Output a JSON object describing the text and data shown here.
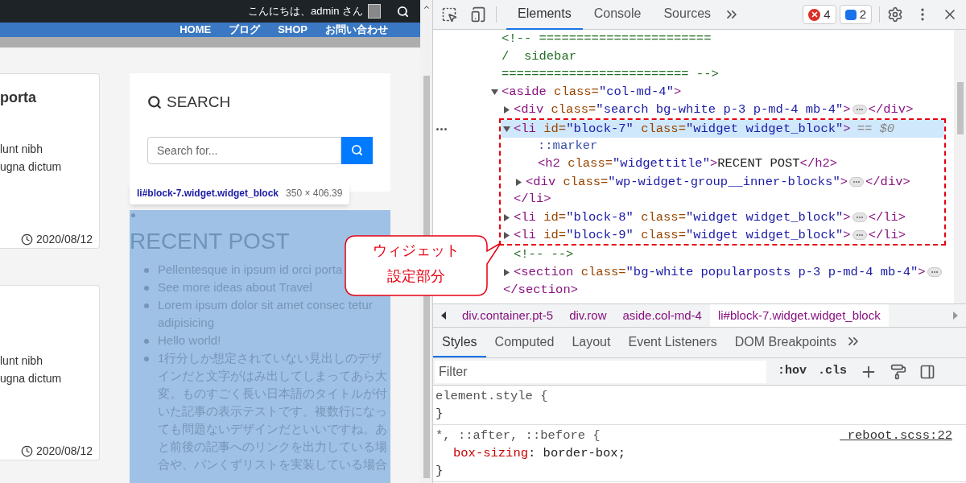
{
  "page": {
    "greeting": "こんにちは、admin さん",
    "nav": [
      "HOME",
      "ブログ",
      "SHOP",
      "お問い合わせ"
    ],
    "posts": [
      {
        "title": "porta",
        "lines": [
          "lunt nibh",
          "ugna dictum"
        ],
        "date": "2020/08/12"
      },
      {
        "lines": [
          "lunt nibh",
          "ugna dictum"
        ],
        "date": "2020/08/12"
      }
    ],
    "search_widget": {
      "title": "SEARCH",
      "placeholder": "Search for..."
    },
    "tooltip": {
      "selector": "li#block-7.widget.widget_block",
      "size": "350 × 406.39"
    },
    "recent": {
      "title": "RECENT POST",
      "items": [
        "Pellentesque in ipsum id orci porta",
        "See more ideas about Travel",
        "Lorem ipsum dolor sit amet consec tetur adipisicing",
        "Hello world!",
        "1行分しか想定されていない見出しのデザインだと文字がはみ出してしまってあら大変。ものすごく長い日本語のタイトルが付いた記事の表示テストです。複数行になっても問題ないデザインだといいですね。あと前後の記事へのリンクを出力している場合や、パンくずリストを実装している場合"
      ]
    }
  },
  "callout": {
    "lines": [
      "ウィジェット",
      "設定部分"
    ]
  },
  "devtools": {
    "tabs": [
      {
        "label": "Elements",
        "selected": true
      },
      {
        "label": "Console",
        "selected": false
      },
      {
        "label": "Sources",
        "selected": false
      }
    ],
    "errors": "4",
    "messages": "2",
    "dom_tree": [
      {
        "kind": "comment",
        "text": "<!-- =======================\n/  sidebar\n========================= -->"
      },
      {
        "kind": "element",
        "open": "<aside class=\"col-md-4\">",
        "expanded": true,
        "selected": false,
        "children": [
          {
            "kind": "element",
            "open": "<div class=\"search bg-white p-3 p-md-4 mb-4\">",
            "close": "</div>",
            "expanded": false,
            "selected": false
          },
          {
            "kind": "element",
            "open": "<li id=\"block-7\" class=\"widget widget_block\">",
            "ref": "== $0",
            "close": "</li>",
            "annotated": true,
            "expanded": true,
            "selected": true,
            "children": [
              {
                "kind": "pseudo",
                "text": "::marker"
              },
              {
                "kind": "leaf",
                "text": "<h2 class=\"widgettitle\">RECENT POST</h2>"
              },
              {
                "kind": "element",
                "open": "<div class=\"wp-widget-group__inner-blocks\">",
                "close": "</div>",
                "expanded": false,
                "selected": false
              }
            ]
          },
          {
            "kind": "element",
            "open": "<li id=\"block-8\" class=\"widget widget_block\">",
            "close": "</li>",
            "annotated": true,
            "expanded": false,
            "selected": false
          },
          {
            "kind": "element",
            "open": "<li id=\"block-9\" class=\"widget widget_block\">",
            "close": "</li>",
            "annotated": true,
            "expanded": false,
            "selected": false
          },
          {
            "kind": "comment",
            "text": "<!-- -->"
          },
          {
            "kind": "element",
            "open": "<section class=\"bg-white popularposts p-3 p-md-4 mb-4\">",
            "close": "</section>",
            "expanded": false,
            "selected": false
          }
        ]
      }
    ],
    "breadcrumbs": [
      {
        "label": "div.container.pt-5",
        "selected": false
      },
      {
        "label": "div.row",
        "selected": false
      },
      {
        "label": "aside.col-md-4",
        "selected": false
      },
      {
        "label": "li#block-7.widget.widget_block",
        "selected": true
      }
    ],
    "styles_tabs": [
      {
        "label": "Styles",
        "selected": true
      },
      {
        "label": "Computed",
        "selected": false
      },
      {
        "label": "Layout",
        "selected": false
      },
      {
        "label": "Event Listeners",
        "selected": false
      },
      {
        "label": "DOM Breakpoints",
        "selected": false
      }
    ],
    "filter": {
      "placeholder": "Filter"
    },
    "filter_buttons": [
      ":hov",
      ".cls"
    ],
    "rules": [
      {
        "selector": "element.style {",
        "close": "}"
      },
      {
        "selector": "*, ::after, ::before {",
        "source": "_reboot.scss:22",
        "declarations": [
          "box-sizing: border-box;"
        ],
        "close": "}"
      }
    ]
  }
}
